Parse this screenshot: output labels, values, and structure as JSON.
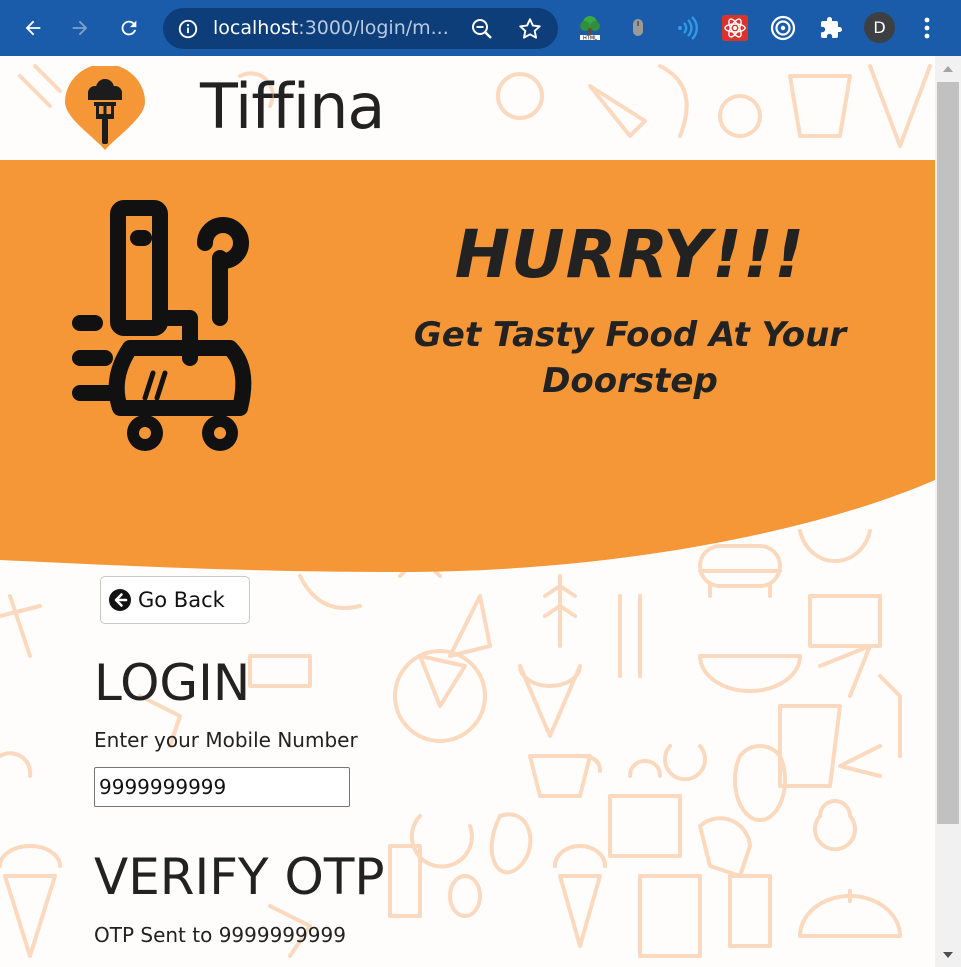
{
  "browser": {
    "url_host": "localhost",
    "url_rest": ":3000/login/m...",
    "profile_initial": "D",
    "extensions": [
      "html-tree-extension-icon",
      "mouse-extension-icon",
      "wireless-extension-icon",
      "react-devtools-icon",
      "target-extension-icon",
      "puzzle-extensions-icon"
    ]
  },
  "header": {
    "brand": "Tiffina"
  },
  "banner": {
    "headline": "HURRY!!!",
    "tagline": "Get Tasty Food At Your Doorstep",
    "color": "#f59736"
  },
  "form": {
    "go_back_label": "Go Back",
    "login_title": "LOGIN",
    "mobile_label": "Enter your Mobile Number",
    "mobile_value": "9999999999",
    "otp_title": "VERIFY OTP",
    "otp_sent_text": "OTP Sent to 9999999999"
  },
  "colors": {
    "chrome": "#1a5ca9",
    "accent": "#f59736",
    "doodle": "#fbd9bf"
  }
}
